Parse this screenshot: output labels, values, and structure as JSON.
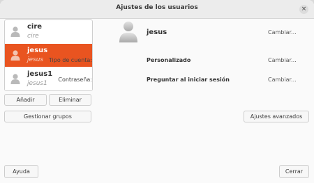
{
  "window": {
    "title": "Ajustes de los usuarios",
    "close_glyph": "×"
  },
  "users": [
    {
      "name": "cire",
      "subtitle": "cire",
      "selected": false
    },
    {
      "name": "jesus",
      "subtitle": "jesus",
      "selected": true
    },
    {
      "name": "jesus1",
      "subtitle": "jesus1",
      "selected": false
    }
  ],
  "list_buttons": {
    "add_label": "Añadir",
    "remove_label": "Eliminar",
    "groups_label": "Gestionar grupos"
  },
  "details": {
    "username": "jesus",
    "change_name_label": "Cambiar...",
    "account_type_label": "Tipo de cuenta:",
    "account_type_value": "Personalizado",
    "change_account_type_label": "Cambiar...",
    "password_label": "Contraseña:",
    "password_value": "Preguntar al iniciar sesión",
    "change_password_label": "Cambiar...",
    "advanced_label": "Ajustes avanzados"
  },
  "footer": {
    "help_label": "Ayuda",
    "close_label": "Cerrar"
  },
  "colors": {
    "accent": "#e95420"
  },
  "icons": {
    "avatar": "user-avatar-icon",
    "close": "close-icon"
  }
}
